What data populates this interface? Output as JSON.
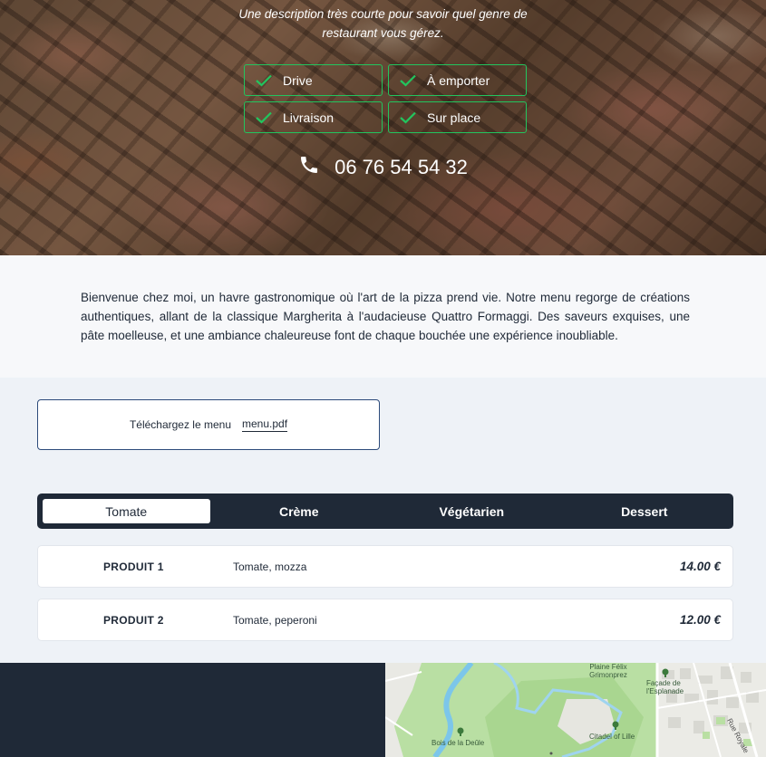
{
  "hero": {
    "tagline_line1": "Une description très courte pour savoir quel genre de",
    "tagline_line2": "restaurant vous gérez.",
    "services": [
      {
        "label": "Drive",
        "icon": "check-icon"
      },
      {
        "label": "À emporter",
        "icon": "check-icon"
      },
      {
        "label": "Livraison",
        "icon": "check-icon"
      },
      {
        "label": "Sur place",
        "icon": "check-icon"
      }
    ],
    "phone": "06 76 54 54 32",
    "phone_icon": "phone-icon",
    "accent_color": "#22c55e"
  },
  "intro": {
    "text": "Bienvenue chez moi, un havre gastronomique où l'art de la pizza prend vie. Notre menu regorge de créations authentiques, allant de la classique Margherita à l'audacieuse Quattro Formaggi. Des saveurs exquises, une pâte moelleuse, et une ambiance chaleureuse font de chaque bouchée une expérience inoubliable."
  },
  "download": {
    "label": "Téléchargez le menu",
    "file": "menu.pdf"
  },
  "tabs": [
    {
      "label": "Tomate",
      "active": true
    },
    {
      "label": "Crème",
      "active": false
    },
    {
      "label": "Végétarien",
      "active": false
    },
    {
      "label": "Dessert",
      "active": false
    }
  ],
  "products": [
    {
      "name": "PRODUIT 1",
      "desc": "Tomate, mozza",
      "price": "14.00 €"
    },
    {
      "name": "PRODUIT 2",
      "desc": "Tomate, peperoni",
      "price": "12.00 €"
    }
  ],
  "map": {
    "labels": {
      "place": "Plaine Félix Grimonprez",
      "facade": "Façade de l'Esplanade",
      "rue": "Rue Royale",
      "bois": "Bois de la Deûle",
      "citadel": "Citadel of Lille"
    }
  },
  "colors": {
    "dark": "#1f2937",
    "border_blue": "#2c4a7a",
    "page_bg": "#eef2f7"
  }
}
